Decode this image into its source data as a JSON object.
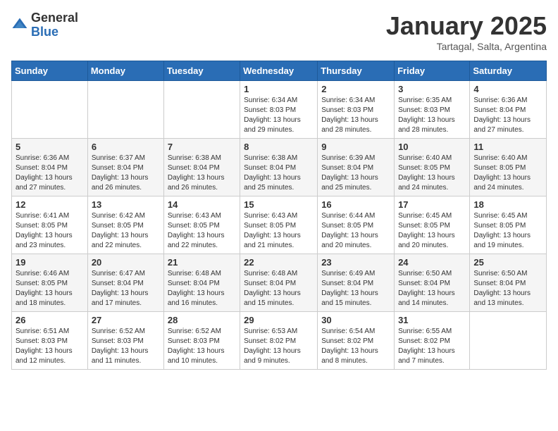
{
  "header": {
    "logo_general": "General",
    "logo_blue": "Blue",
    "title": "January 2025",
    "location": "Tartagal, Salta, Argentina"
  },
  "days_of_week": [
    "Sunday",
    "Monday",
    "Tuesday",
    "Wednesday",
    "Thursday",
    "Friday",
    "Saturday"
  ],
  "weeks": [
    [
      {
        "day": "",
        "info": ""
      },
      {
        "day": "",
        "info": ""
      },
      {
        "day": "",
        "info": ""
      },
      {
        "day": "1",
        "info": "Sunrise: 6:34 AM\nSunset: 8:03 PM\nDaylight: 13 hours\nand 29 minutes."
      },
      {
        "day": "2",
        "info": "Sunrise: 6:34 AM\nSunset: 8:03 PM\nDaylight: 13 hours\nand 28 minutes."
      },
      {
        "day": "3",
        "info": "Sunrise: 6:35 AM\nSunset: 8:03 PM\nDaylight: 13 hours\nand 28 minutes."
      },
      {
        "day": "4",
        "info": "Sunrise: 6:36 AM\nSunset: 8:04 PM\nDaylight: 13 hours\nand 27 minutes."
      }
    ],
    [
      {
        "day": "5",
        "info": "Sunrise: 6:36 AM\nSunset: 8:04 PM\nDaylight: 13 hours\nand 27 minutes."
      },
      {
        "day": "6",
        "info": "Sunrise: 6:37 AM\nSunset: 8:04 PM\nDaylight: 13 hours\nand 26 minutes."
      },
      {
        "day": "7",
        "info": "Sunrise: 6:38 AM\nSunset: 8:04 PM\nDaylight: 13 hours\nand 26 minutes."
      },
      {
        "day": "8",
        "info": "Sunrise: 6:38 AM\nSunset: 8:04 PM\nDaylight: 13 hours\nand 25 minutes."
      },
      {
        "day": "9",
        "info": "Sunrise: 6:39 AM\nSunset: 8:04 PM\nDaylight: 13 hours\nand 25 minutes."
      },
      {
        "day": "10",
        "info": "Sunrise: 6:40 AM\nSunset: 8:05 PM\nDaylight: 13 hours\nand 24 minutes."
      },
      {
        "day": "11",
        "info": "Sunrise: 6:40 AM\nSunset: 8:05 PM\nDaylight: 13 hours\nand 24 minutes."
      }
    ],
    [
      {
        "day": "12",
        "info": "Sunrise: 6:41 AM\nSunset: 8:05 PM\nDaylight: 13 hours\nand 23 minutes."
      },
      {
        "day": "13",
        "info": "Sunrise: 6:42 AM\nSunset: 8:05 PM\nDaylight: 13 hours\nand 22 minutes."
      },
      {
        "day": "14",
        "info": "Sunrise: 6:43 AM\nSunset: 8:05 PM\nDaylight: 13 hours\nand 22 minutes."
      },
      {
        "day": "15",
        "info": "Sunrise: 6:43 AM\nSunset: 8:05 PM\nDaylight: 13 hours\nand 21 minutes."
      },
      {
        "day": "16",
        "info": "Sunrise: 6:44 AM\nSunset: 8:05 PM\nDaylight: 13 hours\nand 20 minutes."
      },
      {
        "day": "17",
        "info": "Sunrise: 6:45 AM\nSunset: 8:05 PM\nDaylight: 13 hours\nand 20 minutes."
      },
      {
        "day": "18",
        "info": "Sunrise: 6:45 AM\nSunset: 8:05 PM\nDaylight: 13 hours\nand 19 minutes."
      }
    ],
    [
      {
        "day": "19",
        "info": "Sunrise: 6:46 AM\nSunset: 8:05 PM\nDaylight: 13 hours\nand 18 minutes."
      },
      {
        "day": "20",
        "info": "Sunrise: 6:47 AM\nSunset: 8:04 PM\nDaylight: 13 hours\nand 17 minutes."
      },
      {
        "day": "21",
        "info": "Sunrise: 6:48 AM\nSunset: 8:04 PM\nDaylight: 13 hours\nand 16 minutes."
      },
      {
        "day": "22",
        "info": "Sunrise: 6:48 AM\nSunset: 8:04 PM\nDaylight: 13 hours\nand 15 minutes."
      },
      {
        "day": "23",
        "info": "Sunrise: 6:49 AM\nSunset: 8:04 PM\nDaylight: 13 hours\nand 15 minutes."
      },
      {
        "day": "24",
        "info": "Sunrise: 6:50 AM\nSunset: 8:04 PM\nDaylight: 13 hours\nand 14 minutes."
      },
      {
        "day": "25",
        "info": "Sunrise: 6:50 AM\nSunset: 8:04 PM\nDaylight: 13 hours\nand 13 minutes."
      }
    ],
    [
      {
        "day": "26",
        "info": "Sunrise: 6:51 AM\nSunset: 8:03 PM\nDaylight: 13 hours\nand 12 minutes."
      },
      {
        "day": "27",
        "info": "Sunrise: 6:52 AM\nSunset: 8:03 PM\nDaylight: 13 hours\nand 11 minutes."
      },
      {
        "day": "28",
        "info": "Sunrise: 6:52 AM\nSunset: 8:03 PM\nDaylight: 13 hours\nand 10 minutes."
      },
      {
        "day": "29",
        "info": "Sunrise: 6:53 AM\nSunset: 8:02 PM\nDaylight: 13 hours\nand 9 minutes."
      },
      {
        "day": "30",
        "info": "Sunrise: 6:54 AM\nSunset: 8:02 PM\nDaylight: 13 hours\nand 8 minutes."
      },
      {
        "day": "31",
        "info": "Sunrise: 6:55 AM\nSunset: 8:02 PM\nDaylight: 13 hours\nand 7 minutes."
      },
      {
        "day": "",
        "info": ""
      }
    ]
  ]
}
